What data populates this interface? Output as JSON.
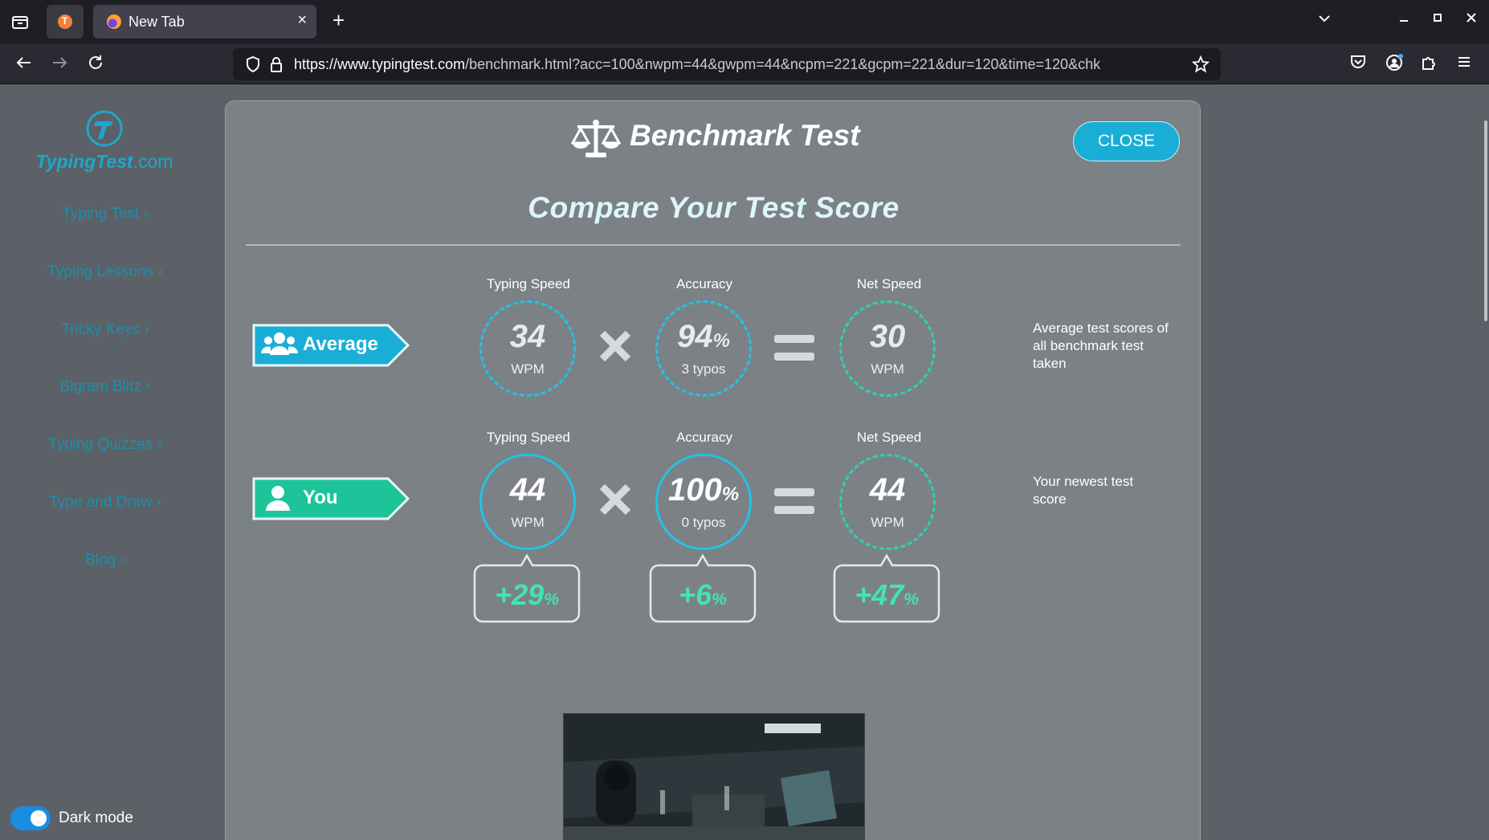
{
  "browser": {
    "tab_title": "New Tab",
    "url_domain": "https://www.typingtest.com",
    "url_path": "/benchmark.html?acc=100&nwpm=44&gwpm=44&ncpm=221&gcpm=221&dur=120&time=120&chk"
  },
  "sidebar": {
    "logo_main": "TypingTest",
    "logo_suffix": ".com",
    "items": [
      {
        "label": "Typing Test ›"
      },
      {
        "label": "Typing Lessons ›"
      },
      {
        "label": "Tricky Keys ›"
      },
      {
        "label": "Bigram Blitz ›"
      },
      {
        "label": "Typing Quizzes ›"
      },
      {
        "label": "Type and Draw ›"
      },
      {
        "label": "Blog ›"
      }
    ],
    "dark_mode_label": "Dark mode",
    "dark_mode_on": true
  },
  "modal": {
    "title": "Benchmark Test",
    "close_label": "CLOSE",
    "subtitle": "Compare Your Test Score",
    "column_labels": {
      "typing_speed": "Typing Speed",
      "accuracy": "Accuracy",
      "net_speed": "Net Speed"
    },
    "average": {
      "tag": "Average",
      "typing_speed": "34",
      "typing_unit": "WPM",
      "accuracy": "94",
      "accuracy_pct": "%",
      "accuracy_sub": "3 typos",
      "net_speed": "30",
      "net_unit": "WPM",
      "description": "Average test scores of all benchmark test taken"
    },
    "you": {
      "tag": "You",
      "typing_speed": "44",
      "typing_unit": "WPM",
      "accuracy": "100",
      "accuracy_pct": "%",
      "accuracy_sub": "0 typos",
      "net_speed": "44",
      "net_unit": "WPM",
      "description": "Your newest test score"
    },
    "diffs": {
      "typing_speed": "+29",
      "accuracy": "+6",
      "net_speed": "+47",
      "pct": "%"
    }
  },
  "colors": {
    "accent_blue": "#22c3e6",
    "accent_teal": "#2ad3b0",
    "diff_green": "#43e3b4",
    "tag_average": "#1aaed6",
    "tag_you": "#1dc49a"
  }
}
